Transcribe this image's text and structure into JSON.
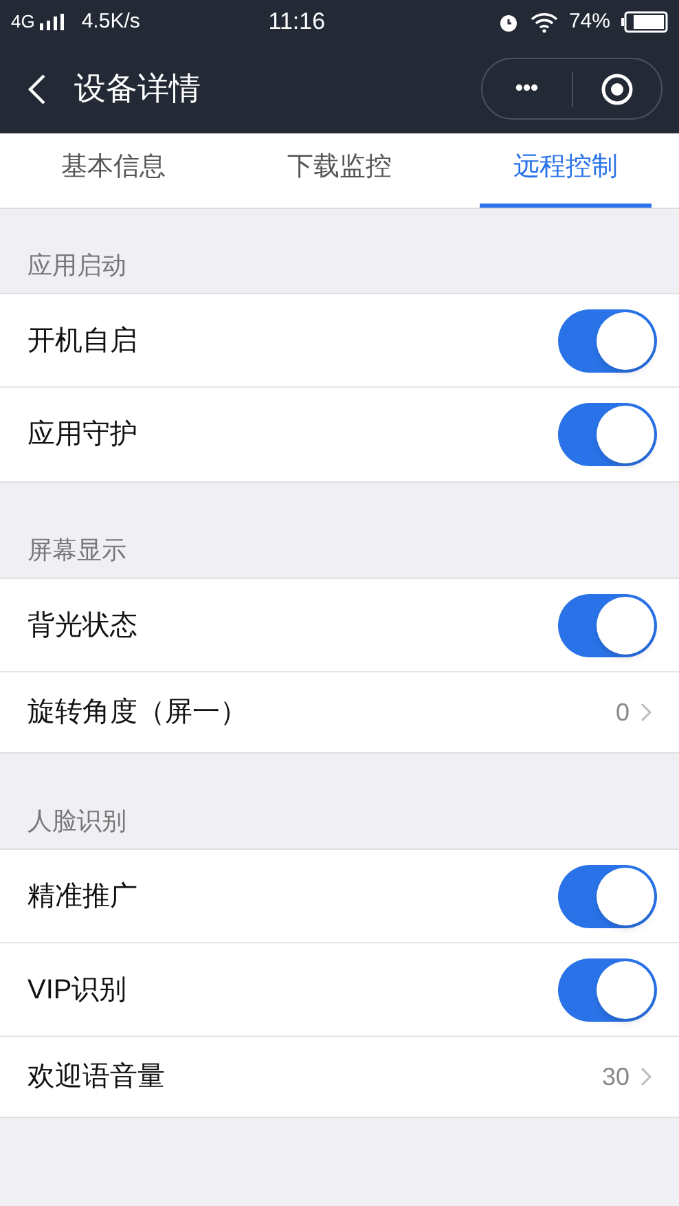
{
  "status_bar": {
    "network": "4G",
    "speed": "4.5K/s",
    "time": "11:16",
    "battery": "74%"
  },
  "nav": {
    "title": "设备详情",
    "more": "•••"
  },
  "tabs": [
    {
      "label": "基本信息",
      "selected": false
    },
    {
      "label": "下载监控",
      "selected": false
    },
    {
      "label": "远程控制",
      "selected": true
    }
  ],
  "sections": [
    {
      "title": "应用启动",
      "rows": [
        {
          "kind": "toggle",
          "label": "开机自启",
          "on": true
        },
        {
          "kind": "toggle",
          "label": "应用守护",
          "on": true
        }
      ]
    },
    {
      "title": "屏幕显示",
      "rows": [
        {
          "kind": "toggle",
          "label": "背光状态",
          "on": true
        },
        {
          "kind": "value",
          "label": "旋转角度（屏一）",
          "value": "0"
        }
      ]
    },
    {
      "title": "人脸识别",
      "rows": [
        {
          "kind": "toggle",
          "label": "精准推广",
          "on": true
        },
        {
          "kind": "toggle",
          "label": "VIP识别",
          "on": true
        },
        {
          "kind": "value",
          "label": "欢迎语音量",
          "value": "30"
        }
      ]
    }
  ]
}
